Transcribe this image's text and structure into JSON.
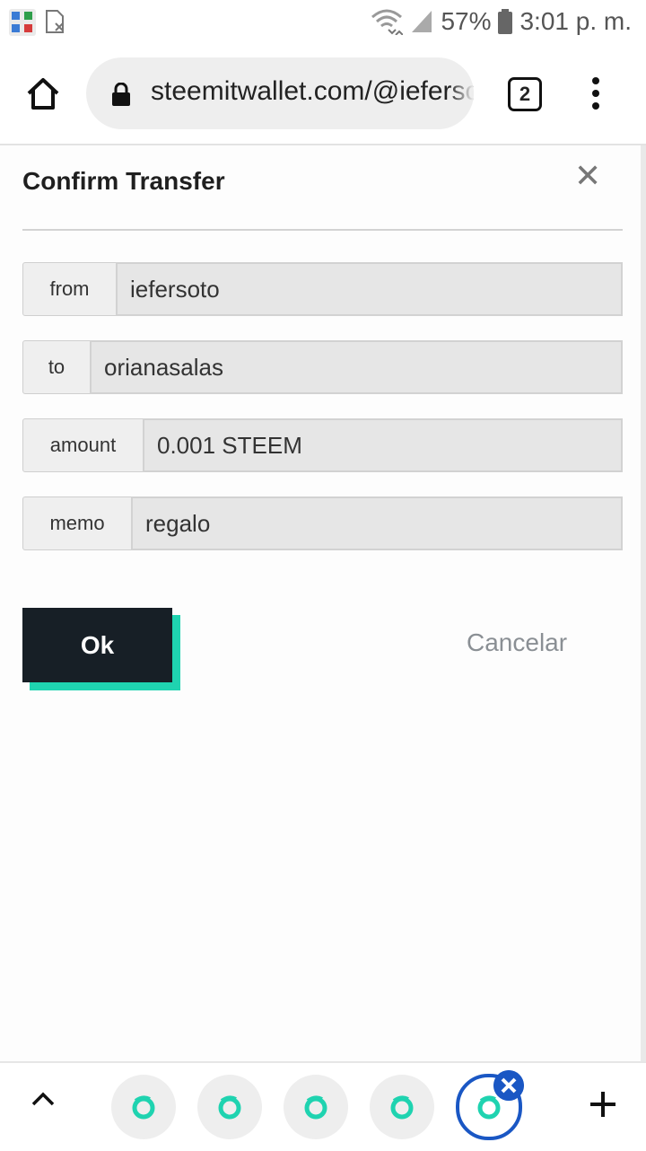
{
  "status_bar": {
    "battery": "57%",
    "time": "3:01 p. m."
  },
  "browser": {
    "url": "steemitwallet.com/@iefersoto",
    "tab_count": "2"
  },
  "dialog": {
    "title": "Confirm Transfer",
    "fields": [
      {
        "label": "from",
        "value": "iefersoto"
      },
      {
        "label": "to",
        "value": "orianasalas"
      },
      {
        "label": "amount",
        "value": "0.001 STEEM"
      },
      {
        "label": "memo",
        "value": "regalo"
      }
    ],
    "ok_label": "Ok",
    "cancel_label": "Cancelar"
  },
  "colors": {
    "ok_button": "#171f26",
    "ok_shadow": "#1fd3b0",
    "active_tab_ring": "#1a57c4",
    "steemit_icon": "#1fd3b0"
  }
}
